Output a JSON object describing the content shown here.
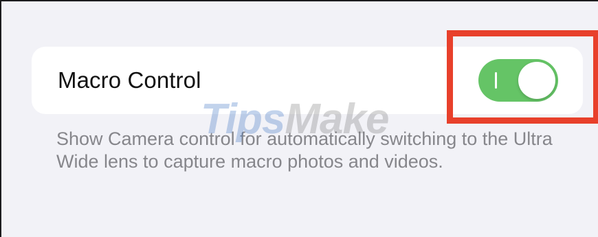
{
  "setting": {
    "label": "Macro Control",
    "toggle_state": "on",
    "toggle_on_glyph": "I",
    "toggle_color": "#65c466"
  },
  "footer": {
    "description": "Show Camera control for automatically switching to the Ultra Wide lens to capture macro photos and videos."
  },
  "annotation": {
    "highlight_color": "#e8402b"
  },
  "watermark": {
    "part1": "Tips",
    "part2": "Make"
  }
}
